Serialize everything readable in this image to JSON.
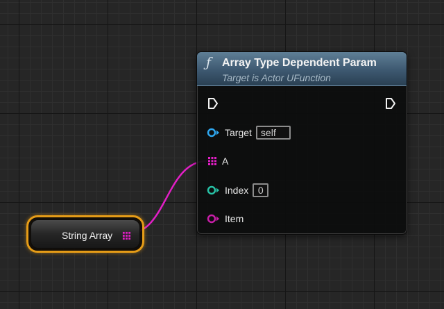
{
  "function_node": {
    "icon": "function-icon",
    "icon_glyph": "ƒ",
    "title": "Array Type Dependent Param",
    "subtitle": "Target is Actor UFunction",
    "header_color": "#3d5870",
    "pins": {
      "target": {
        "label": "Target",
        "value": "self",
        "color": "#2ea7f0"
      },
      "a": {
        "label": "A",
        "color": "#e21fc6"
      },
      "index": {
        "label": "Index",
        "value": "0",
        "color": "#27c2a6"
      },
      "item": {
        "label": "Item",
        "color": "#c81ea8"
      }
    }
  },
  "variable_node": {
    "label": "String Array",
    "border_color": "#e69c17",
    "pin_color": "#e21fc6"
  },
  "wire_color": "#e21fc6"
}
